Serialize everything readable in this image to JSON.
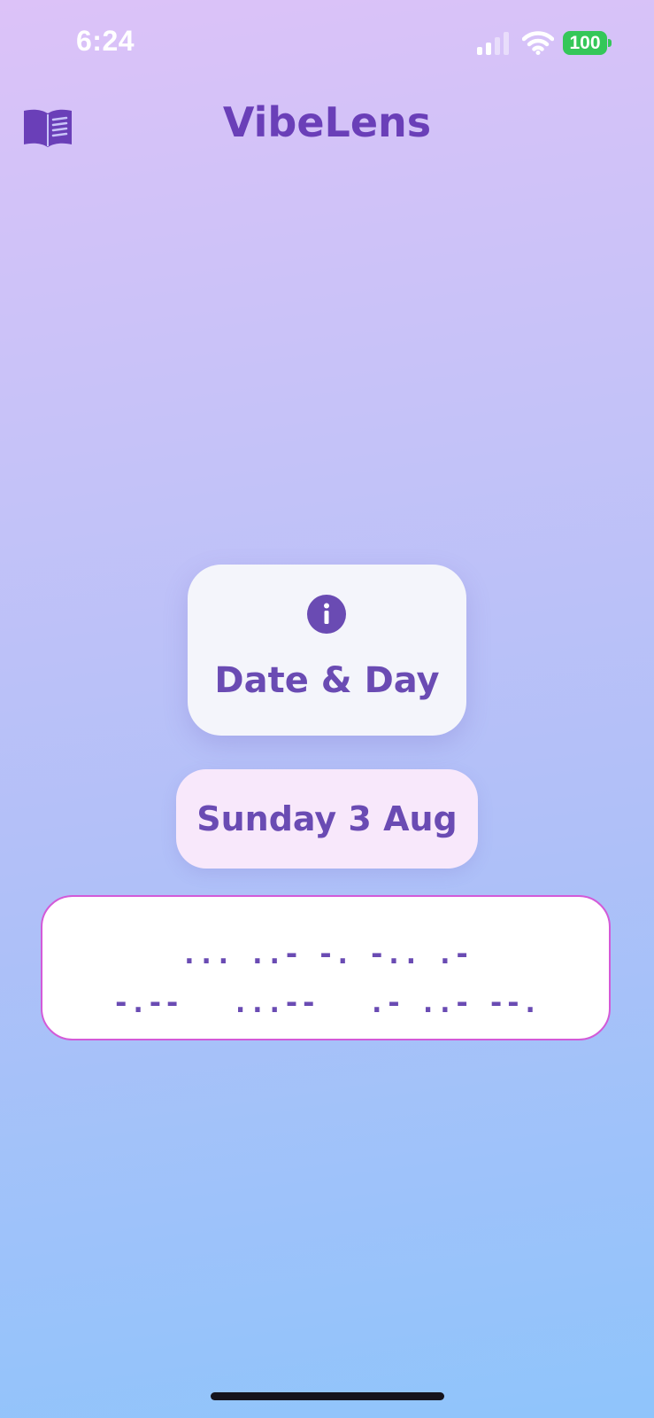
{
  "status_bar": {
    "time": "6:24",
    "battery_level": "100",
    "signal_bars_active": 2,
    "signal_bars_total": 4,
    "icons": [
      "signal-icon",
      "wifi-icon",
      "battery-icon"
    ]
  },
  "header": {
    "title": "VibeLens",
    "menu_icon": "book-icon"
  },
  "category_card": {
    "icon": "info-icon",
    "label": "Date & Day"
  },
  "value_pill": {
    "text": "Sunday 3 Aug"
  },
  "morse": {
    "line1": "... ..- -. -.. .-",
    "line2": "-.--   ...--   .- ..- --."
  },
  "colors": {
    "accent": "#6a4bb3",
    "title": "#6a3fb8",
    "morse_border": "#d35ad8",
    "battery": "#34c759",
    "pill_bg": "#f8e8fb",
    "card_bg": "#f4f5fb"
  }
}
